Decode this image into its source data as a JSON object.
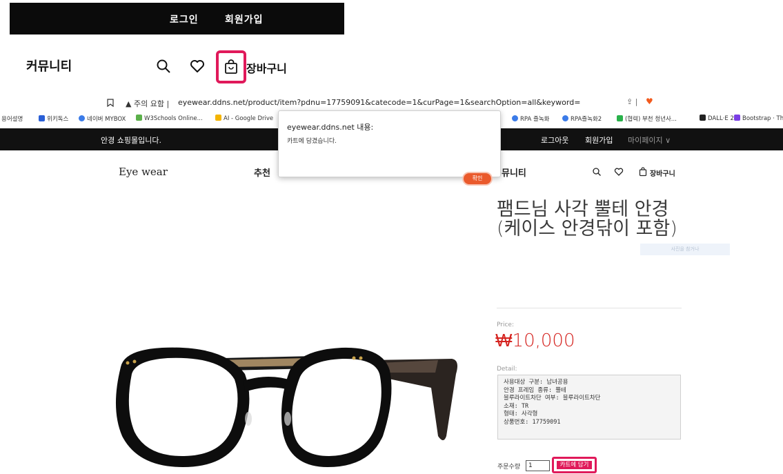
{
  "top_bar": {
    "login": "로그인",
    "signup": "회원가입"
  },
  "zoom_header": {
    "community": "커뮤니티",
    "cart": "장바구니"
  },
  "browser": {
    "url": "eyewear.ddns.net/product/item?pdnu=17759091&catecode=1&curPage=1&searchOption=all&keyword=",
    "security_warning": "주의 요함",
    "bookmarks": [
      "용어설명",
      "위키독스",
      "네이버 MYBOX",
      "W3Schools Online...",
      "AI - Google Drive",
      "RPA 즐녹화",
      "RPA즐녹화2",
      "(협력) 부천 청년사...",
      "DALL·E 2",
      "Bootstrap · The"
    ]
  },
  "site_bar": {
    "welcome": "안경 쇼핑몰입니다.",
    "logout": "로그아웃",
    "signup": "회원가입",
    "mypage": "마이페이지 ∨"
  },
  "nav": {
    "logo": "Eye wear",
    "recommend": "추천",
    "community_partial": "뮤니티",
    "cart": "장바구니"
  },
  "alert": {
    "title": "eyewear.ddns.net 내용:",
    "message": "카트에 담겼습니다.",
    "ok": "확인"
  },
  "product": {
    "title": "팸드님 사각 뿔테 안경 (케이스 안경닦이 포함)",
    "faint_button": "사진을 참거나",
    "price_label": "Price:",
    "price": "₩10,000",
    "detail_label": "Detail:",
    "details": [
      "사용대상 구분: 남녀공용",
      "안경 프레임 종류: 뿔테",
      "블루라이트차단 여부: 블루라이트차단",
      "소재: TR",
      "형태: 사각형",
      "상품번호: 17759091"
    ],
    "qty_label": "주문수량",
    "qty_value": "1",
    "add_to_cart": "카트에 담기"
  },
  "colors": {
    "highlight": "#e0195a",
    "price": "#d5231f",
    "ok_button": "#ea5a2c"
  }
}
